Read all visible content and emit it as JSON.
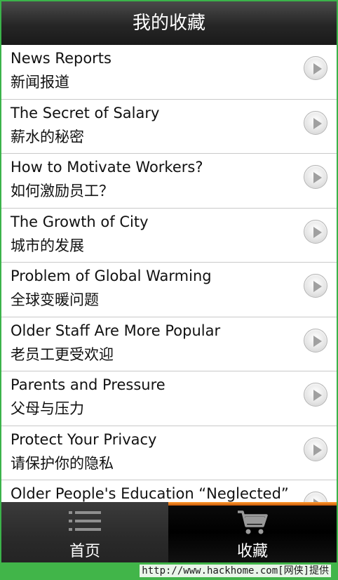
{
  "header": {
    "title": "我的收藏"
  },
  "list": {
    "items": [
      {
        "en": "News Reports",
        "zh": "新闻报道"
      },
      {
        "en": "The Secret of Salary",
        "zh": "薪水的秘密"
      },
      {
        "en": "How to Motivate Workers?",
        "zh": "如何激励员工？"
      },
      {
        "en": "The Growth of City",
        "zh": "城市的发展"
      },
      {
        "en": "Problem of Global Warming",
        "zh": "全球变暖问题"
      },
      {
        "en": "Older Staff Are More Popular",
        "zh": "老员工更受欢迎"
      },
      {
        "en": "Parents and Pressure",
        "zh": "父母与压力"
      },
      {
        "en": "Protect Your Privacy",
        "zh": "请保护你的隐私"
      },
      {
        "en": "Older People's Education “Neglected”",
        "zh": ""
      }
    ],
    "item_icon": "play-arrow-icon"
  },
  "tabs": {
    "home": {
      "label": "首页",
      "icon": "list-icon"
    },
    "favorites": {
      "label": "收藏",
      "icon": "cart-icon",
      "selected": true
    }
  },
  "watermark": {
    "text": "http://www.hackhome.com[网侠]提供"
  },
  "colors": {
    "accent": "#ff9a2e",
    "footer": "#41b549",
    "titlebar": "#262626"
  }
}
